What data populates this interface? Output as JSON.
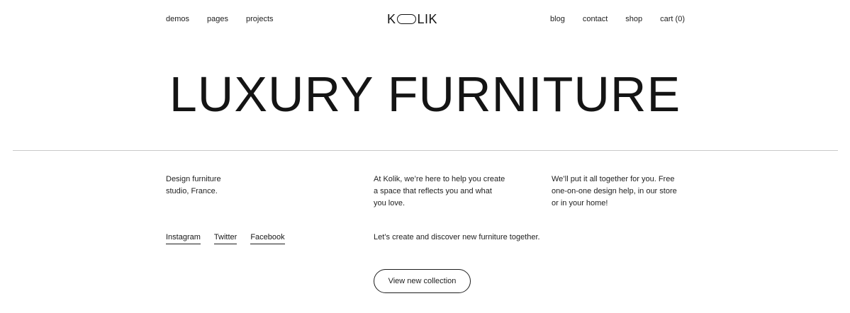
{
  "header": {
    "nav_left": [
      "demos",
      "pages",
      "projects"
    ],
    "logo": {
      "k": "K",
      "rest": "LIK",
      "full": "KOLIK"
    },
    "nav_right": [
      "blog",
      "contact",
      "shop",
      "cart (0)"
    ]
  },
  "hero": {
    "title": "LUXURY FURNITURE"
  },
  "about": {
    "studio_lines": [
      "Design furniture",
      "studio, France."
    ],
    "intro_lines": [
      "At Kolik, we’re here to help you create",
      "a space that reflects you and what",
      "you love."
    ],
    "service_lines": [
      "We’ll put it all together for you. Free",
      "one-on-one design help, in our store",
      "or in your home!"
    ],
    "tagline": "Let’s create and discover new furniture together."
  },
  "social": [
    "Instagram",
    "Twitter",
    "Facebook"
  ],
  "cta": {
    "label": "View new collection"
  }
}
